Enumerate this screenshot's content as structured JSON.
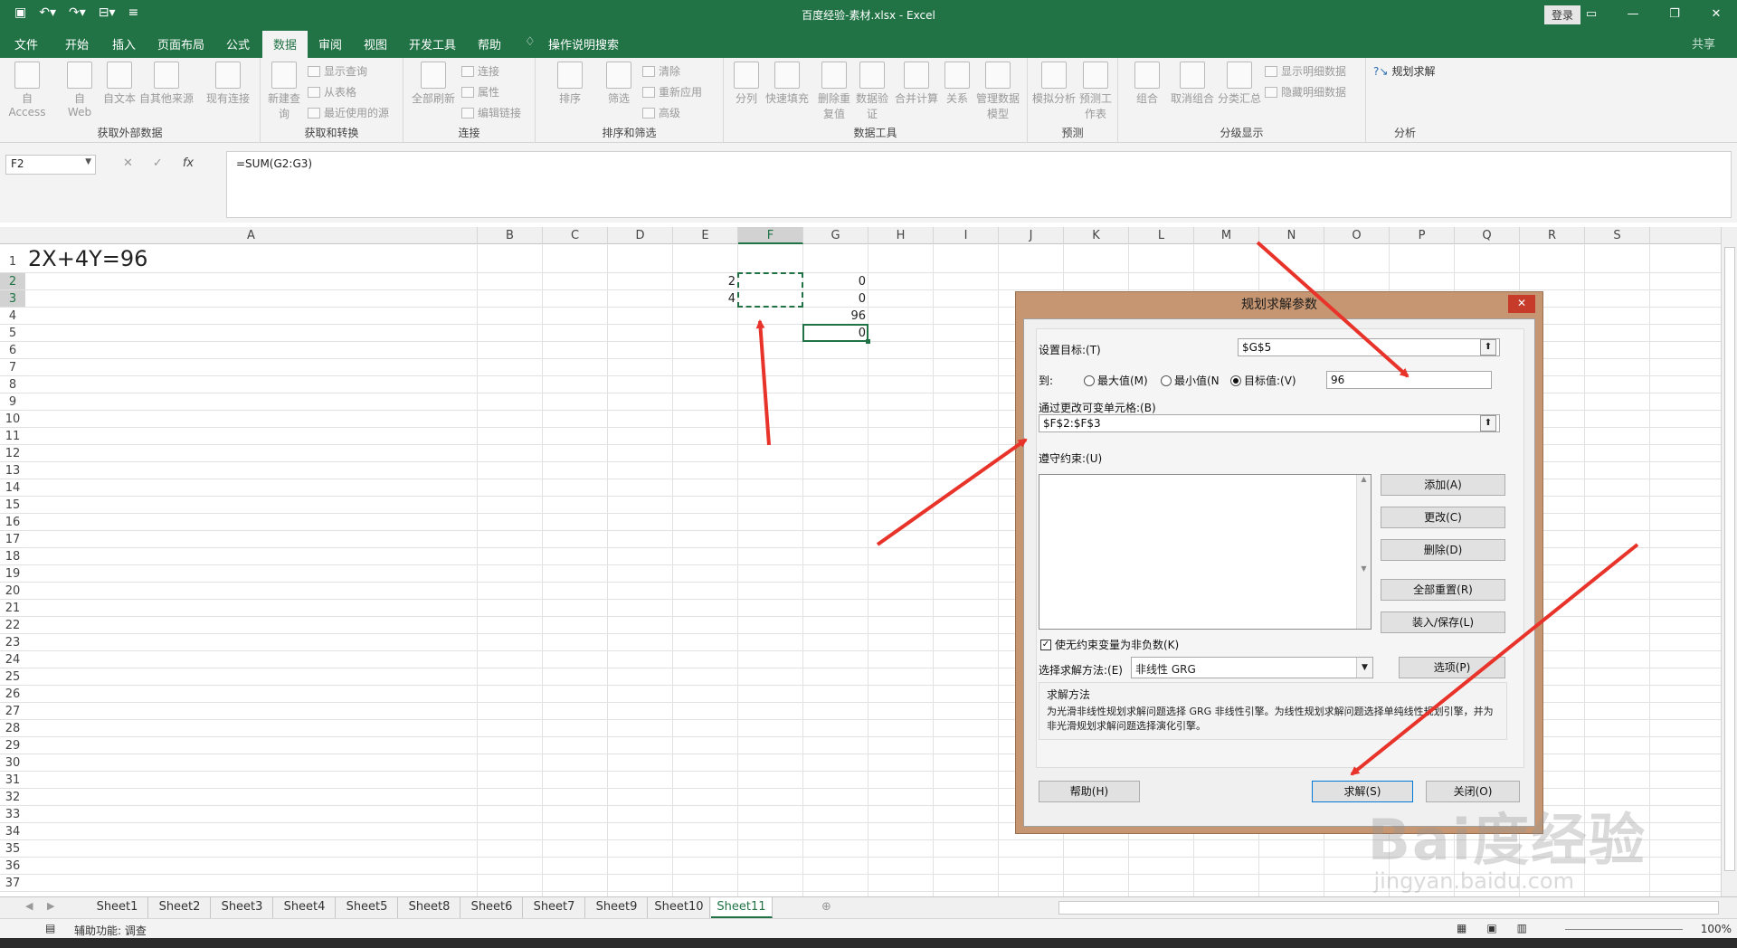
{
  "window": {
    "title": "百度经验-素材.xlsx  -  Excel",
    "login": "登录",
    "share": "共享"
  },
  "tabs": [
    "文件",
    "开始",
    "插入",
    "页面布局",
    "公式",
    "数据",
    "审阅",
    "视图",
    "开发工具",
    "帮助",
    "操作说明搜索"
  ],
  "active_tab": "数据",
  "ribbon": {
    "groups": [
      {
        "label": "获取外部数据",
        "buttons": [
          "自 Access",
          "自 Web",
          "自文本",
          "自其他来源",
          "现有连接"
        ]
      },
      {
        "label": "获取和转换",
        "buttons": [
          "新建查询"
        ],
        "small": [
          "显示查询",
          "从表格",
          "最近使用的源"
        ]
      },
      {
        "label": "连接",
        "buttons": [
          "全部刷新"
        ],
        "small": [
          "连接",
          "属性",
          "编辑链接"
        ]
      },
      {
        "label": "排序和筛选",
        "buttons": [
          "排序",
          "筛选"
        ],
        "small": [
          "清除",
          "重新应用",
          "高级"
        ]
      },
      {
        "label": "数据工具",
        "buttons": [
          "分列",
          "快速填充",
          "删除重复值",
          "数据验证",
          "合并计算",
          "关系",
          "管理数据模型"
        ]
      },
      {
        "label": "预测",
        "buttons": [
          "模拟分析",
          "预测工作表"
        ]
      },
      {
        "label": "分级显示",
        "buttons": [
          "组合",
          "取消组合",
          "分类汇总"
        ],
        "small": [
          "显示明细数据",
          "隐藏明细数据"
        ]
      },
      {
        "label": "分析",
        "small": [
          "规划求解"
        ]
      }
    ]
  },
  "formula_bar": {
    "name_box": "F2",
    "formula": "=SUM(G2:G3)"
  },
  "columns": [
    "A",
    "B",
    "C",
    "D",
    "E",
    "F",
    "G",
    "H",
    "I",
    "J",
    "K",
    "L",
    "M",
    "N",
    "O",
    "P",
    "Q",
    "R",
    "S"
  ],
  "rows": [
    "1",
    "2",
    "3",
    "4",
    "5",
    "6",
    "7",
    "8",
    "9",
    "10",
    "11",
    "12",
    "13",
    "14",
    "15",
    "16",
    "17",
    "18",
    "19",
    "20",
    "21",
    "22",
    "23",
    "24",
    "25",
    "26",
    "27",
    "28",
    "29",
    "30",
    "31",
    "32",
    "33",
    "34",
    "35",
    "36",
    "37"
  ],
  "cells": {
    "A1": "2X+4Y=96",
    "E2": "2",
    "E3": "4",
    "G2": "0",
    "G3": "0",
    "G4": "96",
    "G5": "0"
  },
  "sheets": [
    "Sheet1",
    "Sheet2",
    "Sheet3",
    "Sheet4",
    "Sheet5",
    "Sheet8",
    "Sheet6",
    "Sheet7",
    "Sheet9",
    "Sheet10",
    "Sheet11"
  ],
  "active_sheet": "Sheet11",
  "status": {
    "accessibility": "辅助功能: 调查",
    "zoom": "100%"
  },
  "dialog": {
    "title": "规划求解参数",
    "set_objective_label": "设置目标:(T)",
    "set_objective_value": "$G$5",
    "to_label": "到:",
    "radio_max": "最大值(M)",
    "radio_min": "最小值(N",
    "radio_value": "目标值:(V)",
    "value_of": "96",
    "changing_cells_label": "通过更改可变单元格:(B)",
    "changing_cells_value": "$F$2:$F$3",
    "constraints_label": "遵守约束:(U)",
    "btn_add": "添加(A)",
    "btn_change": "更改(C)",
    "btn_delete": "删除(D)",
    "btn_reset": "全部重置(R)",
    "btn_load_save": "装入/保存(L)",
    "nonneg_label": "使无约束变量为非负数(K)",
    "method_label": "选择求解方法:(E)",
    "method_value": "非线性 GRG",
    "btn_options": "选项(P)",
    "method_title": "求解方法",
    "method_desc": "为光滑非线性规划求解问题选择 GRG 非线性引擎。为线性规划求解问题选择单纯线性规划引擎，并为非光滑规划求解问题选择演化引擎。",
    "btn_help": "帮助(H)",
    "btn_solve": "求解(S)",
    "btn_close": "关闭(O)"
  },
  "watermark": {
    "main": "Bai度经验",
    "sub": "jingyan.baidu.com"
  },
  "colors": {
    "excel_green": "#217346",
    "dialog_frame": "#c59671",
    "arrow_red": "#e8332a"
  }
}
